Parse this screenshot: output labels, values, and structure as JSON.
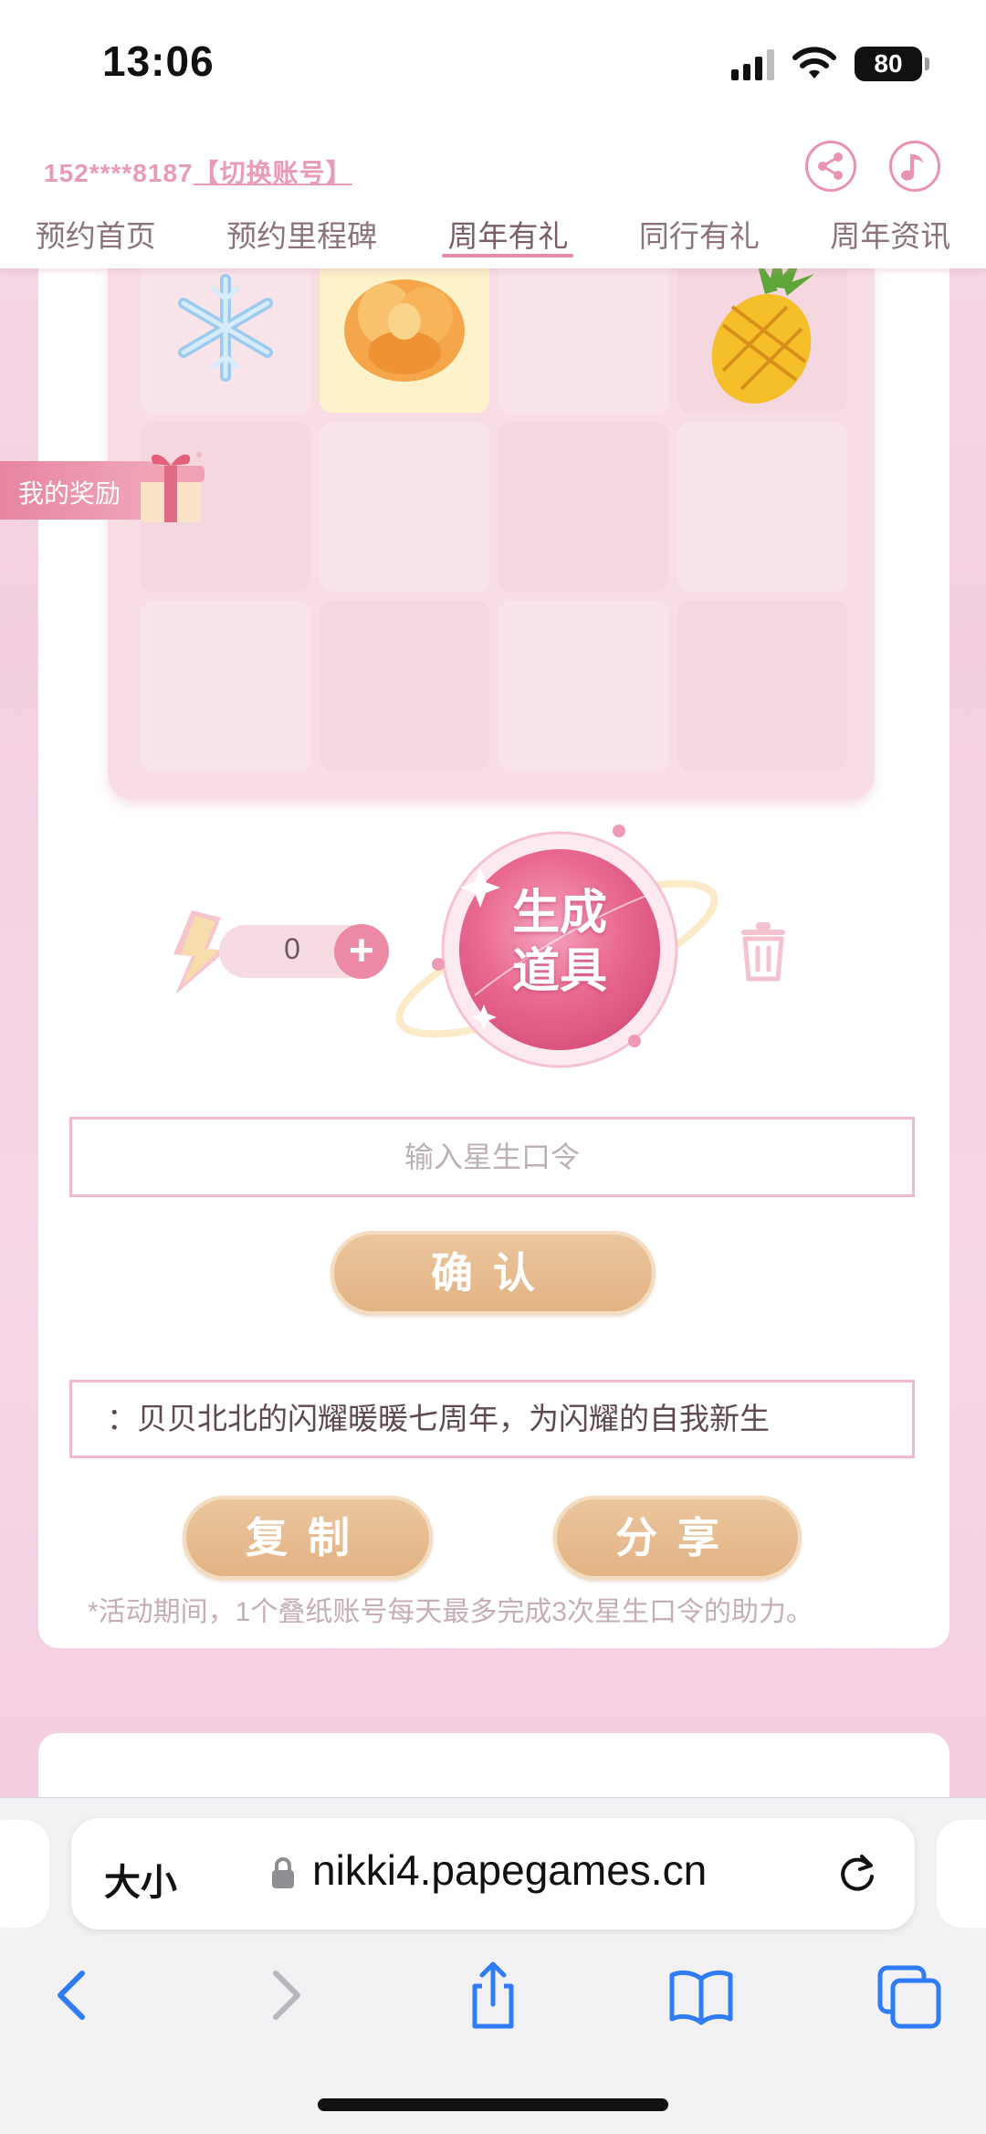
{
  "status_bar": {
    "time": "13:06",
    "battery": "80"
  },
  "header": {
    "account_masked": "152****8187",
    "switch_account": "【切换账号】",
    "share_icon": "share-icon",
    "music_icon": "music-note-icon"
  },
  "nav": {
    "items": [
      {
        "label": "预约首页",
        "active": false
      },
      {
        "label": "预约里程碑",
        "active": false
      },
      {
        "label": "周年有礼",
        "active": true
      },
      {
        "label": "同行有礼",
        "active": false
      },
      {
        "label": "周年资讯",
        "active": false
      }
    ]
  },
  "grid": {
    "rows": 3,
    "cols": 4,
    "items": [
      "snowflake",
      "orange-flower",
      "",
      "pineapple",
      "",
      "",
      "",
      "",
      "",
      "",
      "",
      ""
    ],
    "selected_index": 1
  },
  "rewards": {
    "label": "我的奖励",
    "icon": "gift-icon"
  },
  "generator": {
    "energy_count": "0",
    "energy_icon": "lightning-icon",
    "generate_label": "生成\n道具",
    "trash_icon": "trash-icon"
  },
  "code_form": {
    "placeholder": "输入星生口令",
    "value": "",
    "confirm_label": "确认"
  },
  "share": {
    "text": "：贝贝北北的闪耀暖暖七周年，为闪耀的自我新生",
    "copy_label": "复制",
    "share_label": "分享",
    "note": "*活动期间，1个叠纸账号每天最多完成3次星生口令的助力。"
  },
  "browser": {
    "text_size_label": "大小",
    "url": "nikki4.papegames.cn",
    "toolbar": [
      "back-icon",
      "forward-icon",
      "share-icon",
      "bookmarks-icon",
      "tabs-icon"
    ]
  },
  "colors": {
    "accent_pink": "#e88aa9",
    "gold_button": "#e4b586",
    "background_pink": "#f5d5e4"
  }
}
